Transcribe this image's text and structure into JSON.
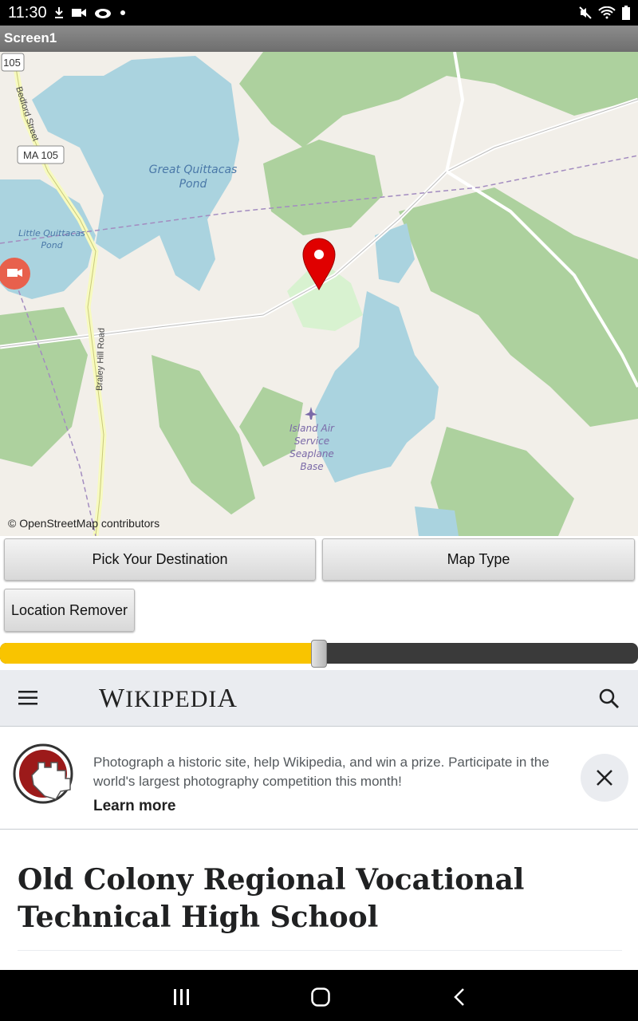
{
  "status_bar": {
    "time": "11:30",
    "icons_left": [
      "download-icon",
      "video-icon",
      "cloud-icon",
      "dot-icon"
    ],
    "icons_right": [
      "mute-icon",
      "wifi-icon",
      "battery-icon"
    ]
  },
  "app": {
    "title": "Screen1"
  },
  "map": {
    "attribution": "© OpenStreetMap contributors",
    "labels": {
      "great_pond_1": "Great Quittacas",
      "great_pond_2": "Pond",
      "little_pond_1": "Little Quittacas",
      "little_pond_2": "Pond",
      "road_ma105": "MA 105",
      "road_105": "105",
      "bedford_street": "Bedford Street",
      "braley_hill_road": "Braley Hill Road",
      "seaplane_1": "Island Air",
      "seaplane_2": "Service",
      "seaplane_3": "Seaplane",
      "seaplane_4": "Base"
    },
    "colors": {
      "land": "#f2efe9",
      "water": "#aad3df",
      "forest": "#add19e",
      "park": "#d8f2d0",
      "marker": "#e00000"
    }
  },
  "buttons": {
    "pick_destination": "Pick Your Destination",
    "map_type": "Map Type",
    "location_remover": "Location Remover"
  },
  "slider": {
    "value": 0.5,
    "fill_color": "#f9c400",
    "track_color": "#3a3a3a"
  },
  "wikipedia": {
    "logo_first": "W",
    "logo_mid": "IKIPEDI",
    "logo_last": "A",
    "banner_text": "Photograph a historic site, help Wikipedia, and win a prize. Participate in the world's largest photography competition this month!",
    "banner_link": "Learn more",
    "article_title": "Old Colony Regional Vocational Technical High School"
  }
}
